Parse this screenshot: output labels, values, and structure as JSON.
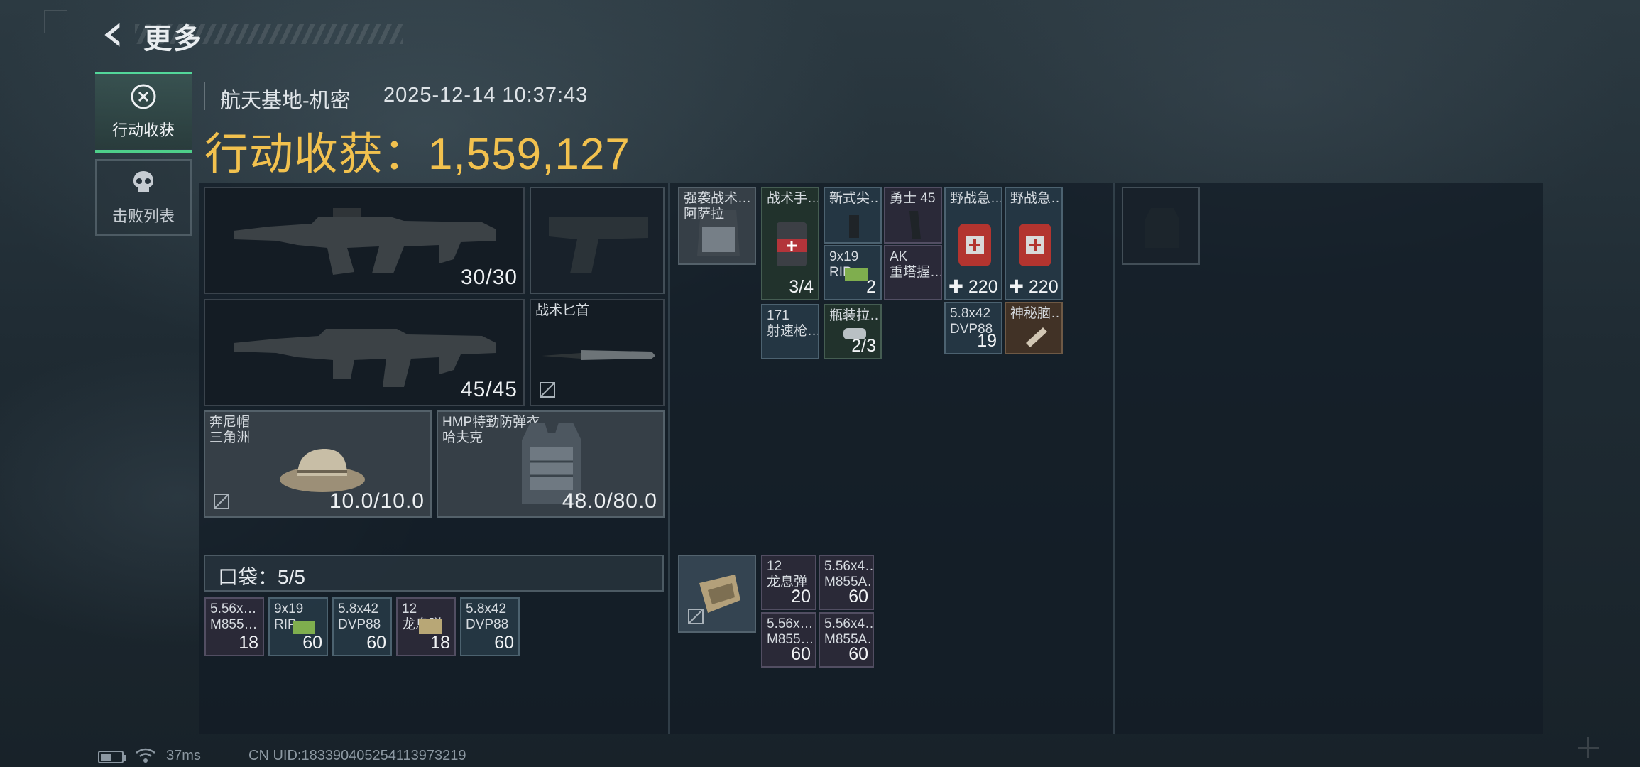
{
  "header": {
    "back_icon": "back-arrow-icon",
    "title": "更多"
  },
  "tabs": [
    {
      "label": "行动收获",
      "icon": "loot-icon",
      "active": true
    },
    {
      "label": "击败列表",
      "icon": "skull-icon",
      "active": false
    }
  ],
  "match": {
    "map": "航天基地-机密",
    "datetime": "2025-12-14 10:37:43",
    "loot_label": "行动收获：",
    "loot_value": "1,559,127"
  },
  "loadout": {
    "primary_weapon": {
      "count": "30/30"
    },
    "secondary_weapon": {
      "count": "45/45"
    },
    "pistol": {},
    "knife": {
      "name": "战术匕首"
    },
    "helmet": {
      "name": "奔尼帽",
      "sub": "三角洲",
      "durability": "10.0/10.0"
    },
    "armor": {
      "name": "HMP特勤防弹衣",
      "sub": "哈夫克",
      "durability": "48.0/80.0"
    }
  },
  "pocket": {
    "label": "口袋：5/5",
    "items": [
      {
        "name": "5.56x…",
        "name2": "M855…",
        "count": "18"
      },
      {
        "name": "9x19",
        "name2": "RIP…",
        "count": "60"
      },
      {
        "name": "5.8x42",
        "name2": "DVP88",
        "count": "60"
      },
      {
        "name": "12",
        "name2": "龙息弹",
        "count": "18"
      },
      {
        "name": "5.8x42",
        "name2": "DVP88",
        "count": "60"
      }
    ]
  },
  "chest_rig": {
    "rig": {
      "name": "强袭战术…",
      "name2": "阿萨拉"
    },
    "items": [
      {
        "name": "战术手…",
        "count": "3/4"
      },
      {
        "name": "新式尖…",
        "count": ""
      },
      {
        "name": "勇士 45",
        "count": ""
      },
      {
        "name": "野战急…",
        "heal": "220"
      },
      {
        "name": "野战急…",
        "heal": "220"
      },
      {
        "name": "9x19",
        "name2": "RIP…",
        "count": "2"
      },
      {
        "name": "AK",
        "name2": "重塔握…",
        "count": ""
      },
      {
        "name": "171",
        "name2": "射速枪…",
        "count": ""
      },
      {
        "name": "瓶装拉…",
        "count": "2/3"
      },
      {
        "name": "5.8x42",
        "name2": "DVP88",
        "count": "19"
      },
      {
        "name": "神秘脑…",
        "count": ""
      }
    ]
  },
  "backpack_items": [
    {
      "name": "12",
      "name2": "龙息弹",
      "count": "20"
    },
    {
      "name": "5.56x4…",
      "name2": "M855A…",
      "count": "60"
    },
    {
      "name": "5.56x…",
      "name2": "M855…",
      "count": "60"
    },
    {
      "name": "5.56x4…",
      "name2": "M855A…",
      "count": "60"
    }
  ],
  "status_bar": {
    "ping": "37ms",
    "uid": "CN UID:18339040525411397321​9"
  }
}
